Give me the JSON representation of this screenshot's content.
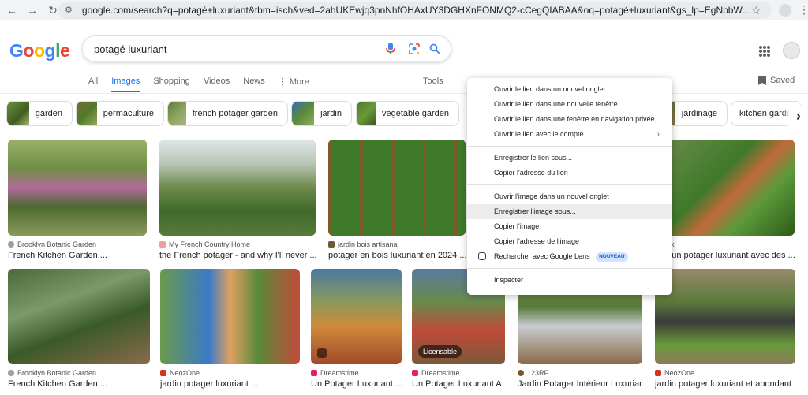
{
  "browser": {
    "url": "google.com/search?q=potagé+luxuriant&tbm=isch&ved=2ahUKEwjq3pnNhfOHAxUY3DGHXnFONMQ2-cCegQIABAA&oq=potagé+luxuriant&gs_lp=EgNpbWciEXBvdGFnw6kgbHV4dXJpYW50SJxXUJ..."
  },
  "header": {
    "logo": [
      "G",
      "o",
      "o",
      "g",
      "l",
      "e"
    ],
    "search_value": "potagé luxuriant"
  },
  "tabs": [
    "All",
    "Images",
    "Shopping",
    "Videos",
    "News",
    "⋮ More"
  ],
  "tools_label": "Tools",
  "saved_label": "Saved",
  "chips": [
    {
      "label": "garden"
    },
    {
      "label": "permaculture"
    },
    {
      "label": "french potager garden"
    },
    {
      "label": "jardin"
    },
    {
      "label": "vegetable garden"
    },
    {
      "label": "jardinage"
    },
    {
      "label": "kitchen garden"
    }
  ],
  "results_row1": [
    {
      "source": "Brooklyn Botanic Garden",
      "title": "French Kitchen Garden ..."
    },
    {
      "source": "My French Country Home",
      "title": "the French potager - and why I'll never ..."
    },
    {
      "source": "jardin bois artisanal",
      "title": "potager en bois luxuriant en 2024 ..."
    },
    {
      "source": "bik",
      "title": "d'un potager luxuriant avec des ..."
    }
  ],
  "results_row2": [
    {
      "source": "Brooklyn Botanic Garden",
      "title": "French Kitchen Garden ..."
    },
    {
      "source": "NeozOne",
      "title": "jardin potager luxuriant ..."
    },
    {
      "source": "Dreamstime",
      "title": "Un Potager Luxuriant ..."
    },
    {
      "source": "Dreamstime",
      "title": "Un Potager Luxuriant A...",
      "badge": "Licensable"
    },
    {
      "source": "123RF",
      "title": "Jardin Potager Intérieur Luxuriant..."
    },
    {
      "source": "NeozOne",
      "title": "jardin potager luxuriant et abondant ..."
    }
  ],
  "context_menu": {
    "items": [
      "Ouvrir le lien dans un nouvel onglet",
      "Ouvrir le lien dans une nouvelle fenêtre",
      "Ouvrir le lien dans une fenêtre en navigation privée",
      "Ouvrir le lien avec le compte",
      "Enregistrer le lien sous...",
      "Copier l'adresse du lien",
      "Ouvrir l'image dans un nouvel onglet",
      "Enregistrer l'image sous...",
      "Copier l'image",
      "Copier l'adresse de l'image",
      "Rechercher avec Google Lens",
      "Inspecter"
    ],
    "nouveau_badge": "NOUVEAU",
    "highlighted": "Enregistrer l'image sous..."
  },
  "colors": {
    "accent": "#1a73e8",
    "menu_highlight": "#ececec"
  }
}
